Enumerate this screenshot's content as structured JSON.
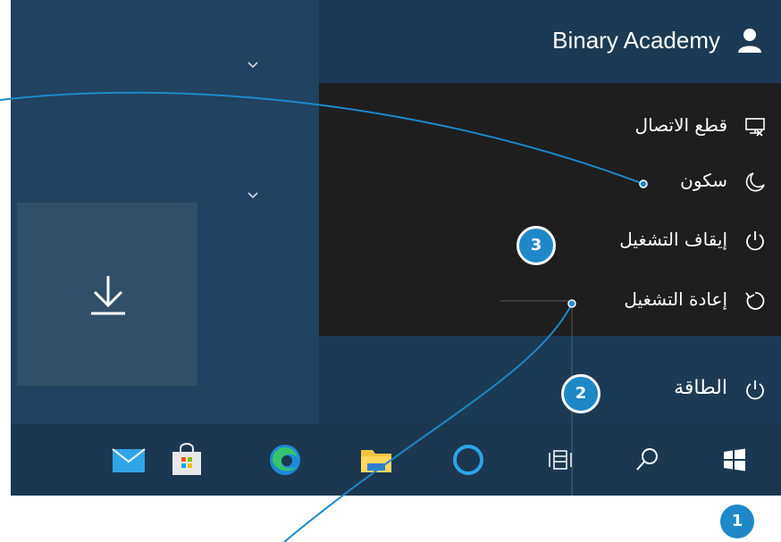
{
  "user": {
    "name": "Binary Academy",
    "avatar_icon": "user-avatar-icon"
  },
  "power_menu": {
    "items": [
      {
        "label": "قطع الاتصال",
        "icon": "disconnect-icon"
      },
      {
        "label": "سكون",
        "icon": "sleep-moon-icon"
      },
      {
        "label": "إيقاف التشغيل",
        "icon": "power-icon"
      },
      {
        "label": "إعادة التشغيل",
        "icon": "restart-icon"
      }
    ]
  },
  "power_button": {
    "label": "الطاقة",
    "icon": "power-icon"
  },
  "tile": {
    "icon": "download-arrow-icon"
  },
  "taskbar": {
    "icons": [
      "mail-icon",
      "store-icon",
      "edge-icon",
      "file-explorer-icon",
      "cortana-icon",
      "task-view-icon",
      "search-icon",
      "windows-start-icon"
    ]
  },
  "callouts": {
    "one": "1",
    "two": "2",
    "three": "3"
  },
  "colors": {
    "accent": "#1e88c9",
    "menu_bg": "#1e1e1e",
    "panel_bg": "#1b3a55"
  }
}
